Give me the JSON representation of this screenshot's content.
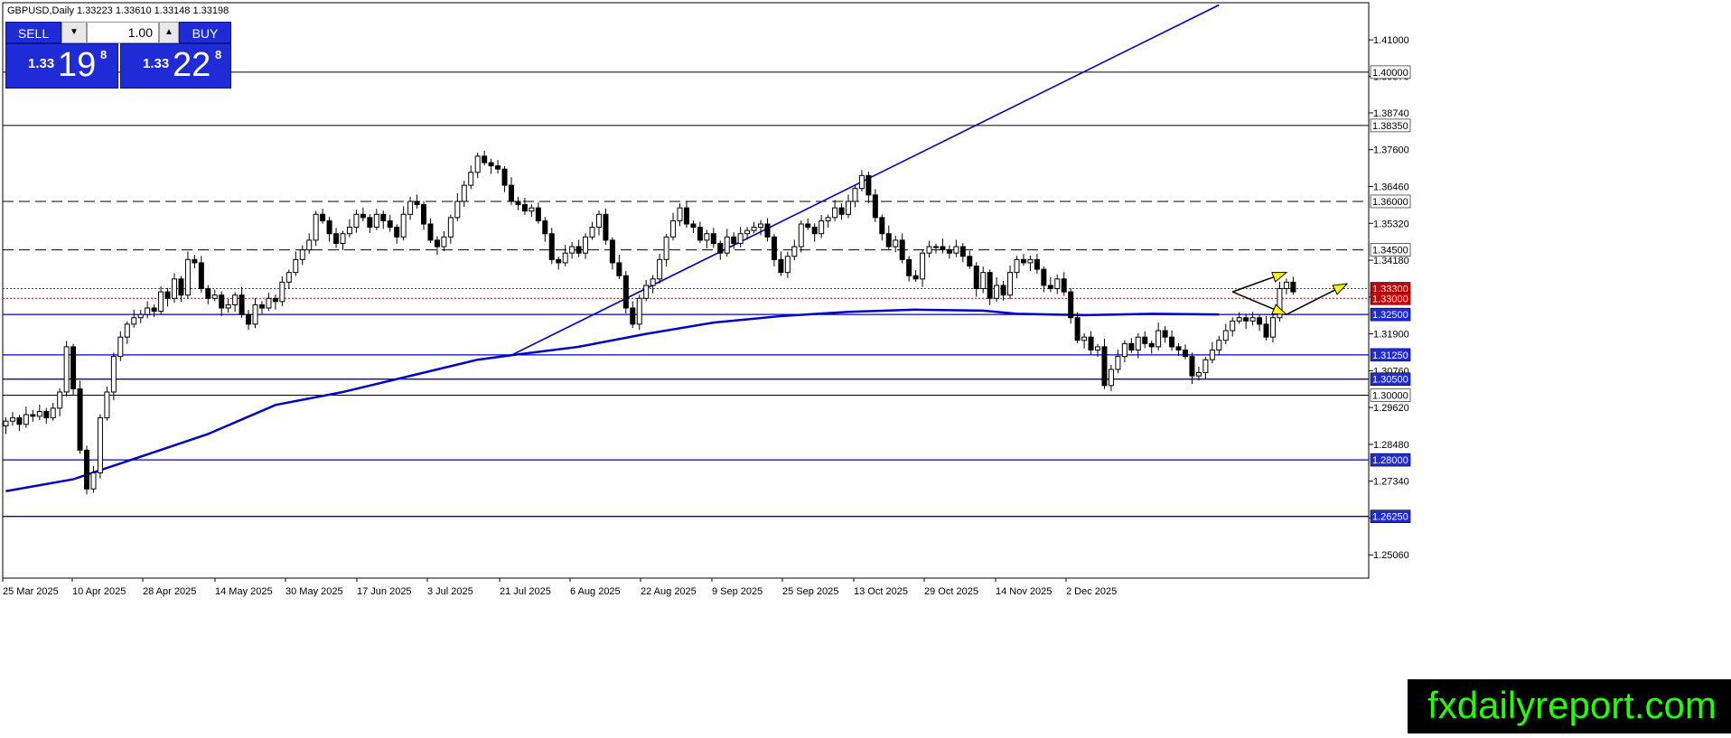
{
  "header": {
    "symbol_info": "GBPUSD,Daily  1.33223 1.33610 1.33148 1.33198"
  },
  "trade_panel": {
    "sell_label": "SELL",
    "buy_label": "BUY",
    "lot_value": "1.00",
    "sell_big": "1.33",
    "sell_pips": "19",
    "sell_frac": "8",
    "buy_big": "1.33",
    "buy_pips": "22",
    "buy_frac": "8"
  },
  "brand": "fxdailyreport.com",
  "colors": {
    "accent_blue": "#0000cc",
    "bull": "#ffffff",
    "bear": "#000000",
    "resistance_red": "#cc0000",
    "label_blue": "#1f2bd6",
    "arrow_yellow": "#ffff00"
  },
  "chart_data": {
    "type": "candlestick",
    "title": "GBPUSD,Daily",
    "ylim": [
      1.2434,
      1.4215
    ],
    "y_ticks": [
      "1.41000",
      "1.39870",
      "1.38740",
      "1.37600",
      "1.36460",
      "1.35320",
      "1.34180",
      "1.33040",
      "1.31900",
      "1.30760",
      "1.29620",
      "1.28480",
      "1.27340",
      "1.26200",
      "1.25060"
    ],
    "x_ticks": [
      "25 Mar 2025",
      "10 Apr 2025",
      "28 Apr 2025",
      "14 May 2025",
      "30 May 2025",
      "17 Jun 2025",
      "3 Jul 2025",
      "21 Jul 2025",
      "6 Aug 2025",
      "22 Aug 2025",
      "9 Sep 2025",
      "25 Sep 2025",
      "13 Oct 2025",
      "29 Oct 2025",
      "14 Nov 2025",
      "2 Dec 2025"
    ],
    "price_levels": [
      {
        "label": "1.40000",
        "value": 1.4,
        "style": "solid",
        "color": "#000000"
      },
      {
        "label": "1.38350",
        "value": 1.3835,
        "style": "solid",
        "color": "#000000"
      },
      {
        "label": "1.36000",
        "value": 1.36,
        "style": "dashed",
        "color": "#000000"
      },
      {
        "label": "1.34500",
        "value": 1.345,
        "style": "dashed",
        "color": "#000000"
      },
      {
        "label": "1.33300",
        "value": 1.333,
        "style": "dotted",
        "color": "#cc0000"
      },
      {
        "label": "1.33000",
        "value": 1.33,
        "style": "dotted",
        "color": "#cc0000"
      },
      {
        "label": "1.32500",
        "value": 1.325,
        "style": "solid",
        "color": "#0000cc"
      },
      {
        "label": "1.31250",
        "value": 1.3125,
        "style": "solid",
        "color": "#0000cc"
      },
      {
        "label": "1.30500",
        "value": 1.305,
        "style": "solid",
        "color": "#0000cc"
      },
      {
        "label": "1.30000",
        "value": 1.3,
        "style": "solid",
        "color": "#000000"
      },
      {
        "label": "1.28000",
        "value": 1.28,
        "style": "solid",
        "color": "#0000cc"
      },
      {
        "label": "1.26250",
        "value": 1.2625,
        "style": "solid",
        "color": "#0000cc"
      }
    ],
    "trendline": {
      "from": [
        75,
        1.3124
      ],
      "to": [
        180,
        1.4208
      ]
    },
    "moving_average": [
      [
        0,
        1.2703
      ],
      [
        10,
        1.274
      ],
      [
        20,
        1.281
      ],
      [
        30,
        1.288
      ],
      [
        40,
        1.297
      ],
      [
        50,
        1.301
      ],
      [
        60,
        1.306
      ],
      [
        70,
        1.311
      ],
      [
        75,
        1.3124
      ],
      [
        85,
        1.315
      ],
      [
        95,
        1.319
      ],
      [
        105,
        1.3225
      ],
      [
        115,
        1.3245
      ],
      [
        125,
        1.3258
      ],
      [
        135,
        1.3265
      ],
      [
        145,
        1.3262
      ],
      [
        150,
        1.3252
      ],
      [
        160,
        1.3248
      ],
      [
        170,
        1.3252
      ],
      [
        180,
        1.325
      ]
    ],
    "arrows": [
      {
        "from": [
          182,
          1.332
        ],
        "to": [
          190,
          1.338
        ]
      },
      {
        "from": [
          182,
          1.332
        ],
        "to": [
          190,
          1.325
        ]
      },
      {
        "from": [
          190,
          1.325
        ],
        "to": [
          199,
          1.3345
        ]
      }
    ],
    "closes": [
      1.292,
      1.293,
      1.291,
      1.294,
      1.2935,
      1.295,
      1.293,
      1.296,
      1.301,
      1.315,
      1.302,
      1.283,
      1.271,
      1.276,
      1.293,
      1.301,
      1.312,
      1.318,
      1.322,
      1.324,
      1.325,
      1.327,
      1.326,
      1.332,
      1.33,
      1.336,
      1.331,
      1.342,
      1.341,
      1.333,
      1.33,
      1.331,
      1.327,
      1.328,
      1.331,
      1.325,
      1.322,
      1.328,
      1.327,
      1.33,
      1.329,
      1.335,
      1.338,
      1.342,
      1.345,
      1.348,
      1.356,
      1.354,
      1.35,
      1.347,
      1.35,
      1.352,
      1.356,
      1.355,
      1.352,
      1.356,
      1.354,
      1.352,
      1.349,
      1.356,
      1.36,
      1.359,
      1.353,
      1.348,
      1.346,
      1.349,
      1.355,
      1.36,
      1.365,
      1.369,
      1.374,
      1.372,
      1.371,
      1.37,
      1.365,
      1.36,
      1.359,
      1.357,
      1.358,
      1.354,
      1.35,
      1.342,
      1.341,
      1.344,
      1.346,
      1.344,
      1.349,
      1.352,
      1.356,
      1.348,
      1.341,
      1.337,
      1.327,
      1.322,
      1.33,
      1.334,
      1.336,
      1.342,
      1.349,
      1.354,
      1.358,
      1.353,
      1.352,
      1.348,
      1.35,
      1.347,
      1.344,
      1.349,
      1.347,
      1.35,
      1.351,
      1.352,
      1.353,
      1.349,
      1.342,
      1.338,
      1.343,
      1.346,
      1.353,
      1.352,
      1.35,
      1.354,
      1.355,
      1.358,
      1.356,
      1.36,
      1.364,
      1.368,
      1.362,
      1.355,
      1.35,
      1.346,
      1.348,
      1.342,
      1.337,
      1.336,
      1.344,
      1.346,
      1.346,
      1.345,
      1.344,
      1.346,
      1.343,
      1.34,
      1.333,
      1.338,
      1.33,
      1.334,
      1.331,
      1.338,
      1.342,
      1.341,
      1.342,
      1.339,
      1.334,
      1.333,
      1.336,
      1.332,
      1.324,
      1.317,
      1.318,
      1.314,
      1.315,
      1.303,
      1.308,
      1.312,
      1.316,
      1.314,
      1.318,
      1.316,
      1.315,
      1.32,
      1.318,
      1.315,
      1.314,
      1.312,
      1.306,
      1.307,
      1.311,
      1.314,
      1.317,
      1.32,
      1.323,
      1.324,
      1.323,
      1.324,
      1.322,
      1.318,
      1.324,
      1.333,
      1.335,
      1.332
    ]
  }
}
